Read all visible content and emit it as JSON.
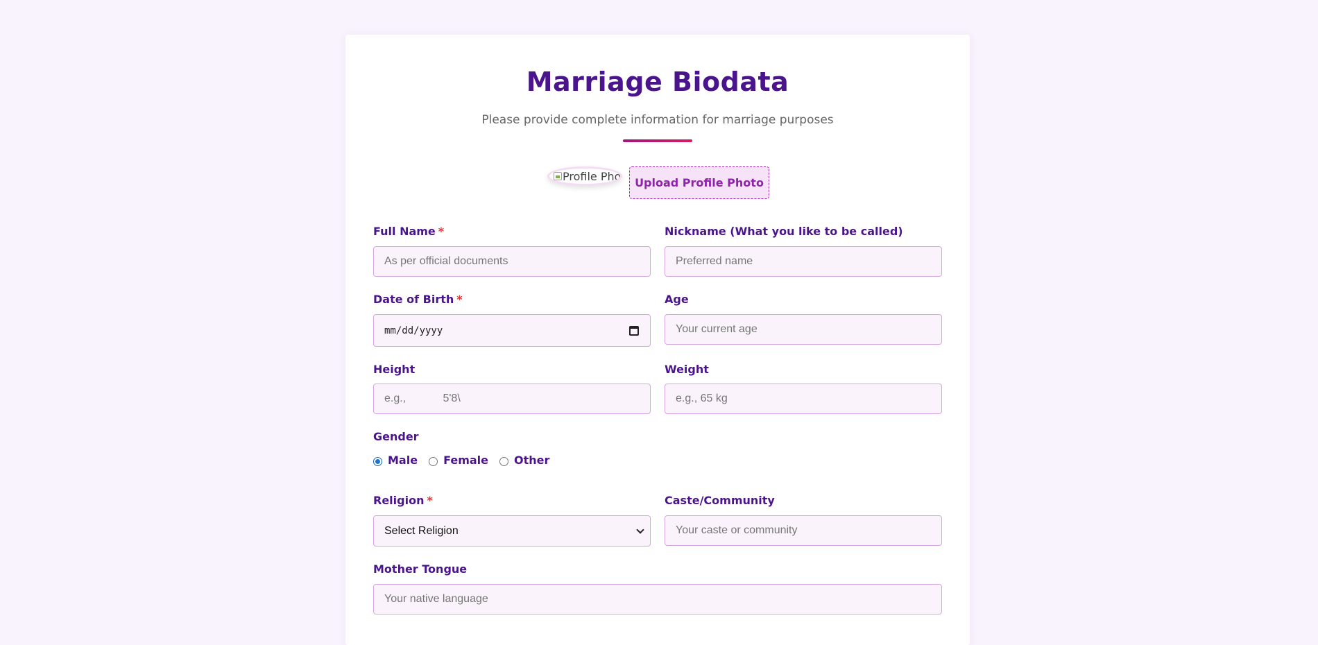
{
  "header": {
    "title": "Marriage Biodata",
    "subtitle": "Please provide complete information for marriage purposes"
  },
  "photo": {
    "alt": "Profile Photo",
    "upload_label": "Upload Profile Photo"
  },
  "fields": {
    "full_name": {
      "label": "Full Name",
      "required": "*",
      "placeholder": "As per official documents"
    },
    "nickname": {
      "label": "Nickname (What you like to be called)",
      "placeholder": "Preferred name"
    },
    "dob": {
      "label": "Date of Birth",
      "required": "*",
      "value": "mm/dd/yyyy"
    },
    "age": {
      "label": "Age",
      "placeholder": "Your current age"
    },
    "height": {
      "label": "Height",
      "placeholder": "e.g.,            5'8\\"
    },
    "weight": {
      "label": "Weight",
      "placeholder": "e.g., 65 kg"
    },
    "religion": {
      "label": "Religion",
      "required": "*",
      "selected": "Select Religion"
    },
    "caste": {
      "label": "Caste/Community",
      "placeholder": "Your caste or community"
    },
    "mother_tongue": {
      "label": "Mother Tongue",
      "placeholder": "Your native language"
    }
  },
  "gender": {
    "label": "Gender",
    "options": [
      "Male",
      "Female",
      "Other"
    ],
    "selected": "Male"
  },
  "icons": {
    "date_picker": "calendar-icon",
    "select_arrow": "chevron-down-icon",
    "photo_placeholder": "broken-image-icon"
  },
  "colors": {
    "page_background": "#f9f3fd",
    "heading": "#4a148c",
    "accent": "#8e24aa",
    "required": "#e53935",
    "input_border": "#d7a6e0",
    "input_background": "#fbf3fc"
  }
}
